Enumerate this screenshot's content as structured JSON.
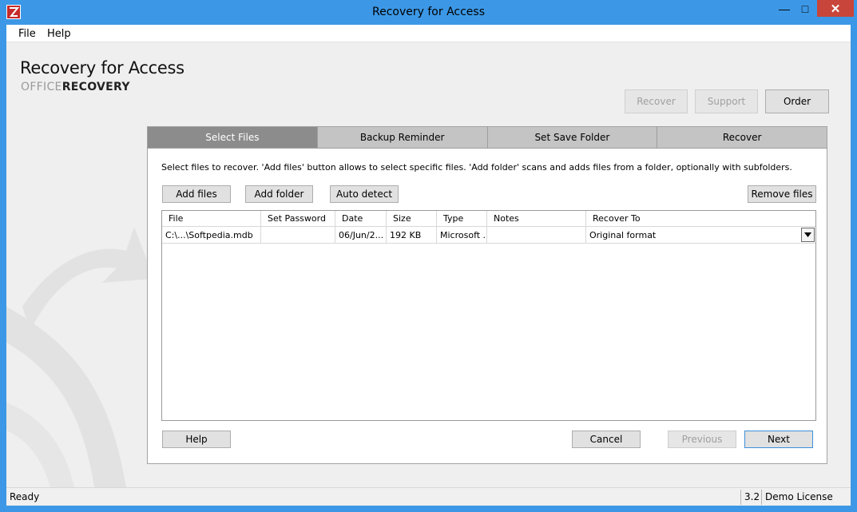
{
  "window": {
    "title": "Recovery for Access",
    "icon": "app-logo-icon",
    "close_glyph": "✕",
    "max_glyph": "□",
    "min_glyph": "—"
  },
  "menu": {
    "items": [
      "File",
      "Help"
    ]
  },
  "header": {
    "product_title": "Recovery for Access",
    "brand_prefix": "OFFICE",
    "brand_suffix": "RECOVERY"
  },
  "top_buttons": {
    "recover": "Recover",
    "support": "Support",
    "order": "Order"
  },
  "tabs": [
    "Select Files",
    "Backup Reminder",
    "Set Save Folder",
    "Recover"
  ],
  "active_tab": "Select Files",
  "instructions": "Select files to recover. 'Add files' button allows to select specific files. 'Add folder' scans and adds files from a folder, optionally with subfolders.",
  "file_buttons": {
    "add_files": "Add files",
    "add_folder": "Add folder",
    "auto_detect": "Auto detect",
    "remove_files": "Remove files"
  },
  "grid": {
    "columns": [
      "File",
      "Set Password",
      "Date",
      "Size",
      "Type",
      "Notes",
      "Recover To"
    ],
    "rows": [
      {
        "file": "C:\\...\\Softpedia.mdb",
        "password": "",
        "date": "06/Jun/2...",
        "size": "192 KB",
        "type": "Microsoft ...",
        "notes": "",
        "recover_to": "Original format"
      }
    ]
  },
  "bottom_buttons": {
    "help": "Help",
    "cancel": "Cancel",
    "previous": "Previous",
    "next": "Next"
  },
  "status": {
    "text": "Ready",
    "version": "3.2",
    "license": "Demo License"
  },
  "colors": {
    "titlebar": "#3c98e6",
    "close": "#c7453a",
    "active_tab": "#8c8c8c",
    "tab": "#c4c4c4"
  }
}
